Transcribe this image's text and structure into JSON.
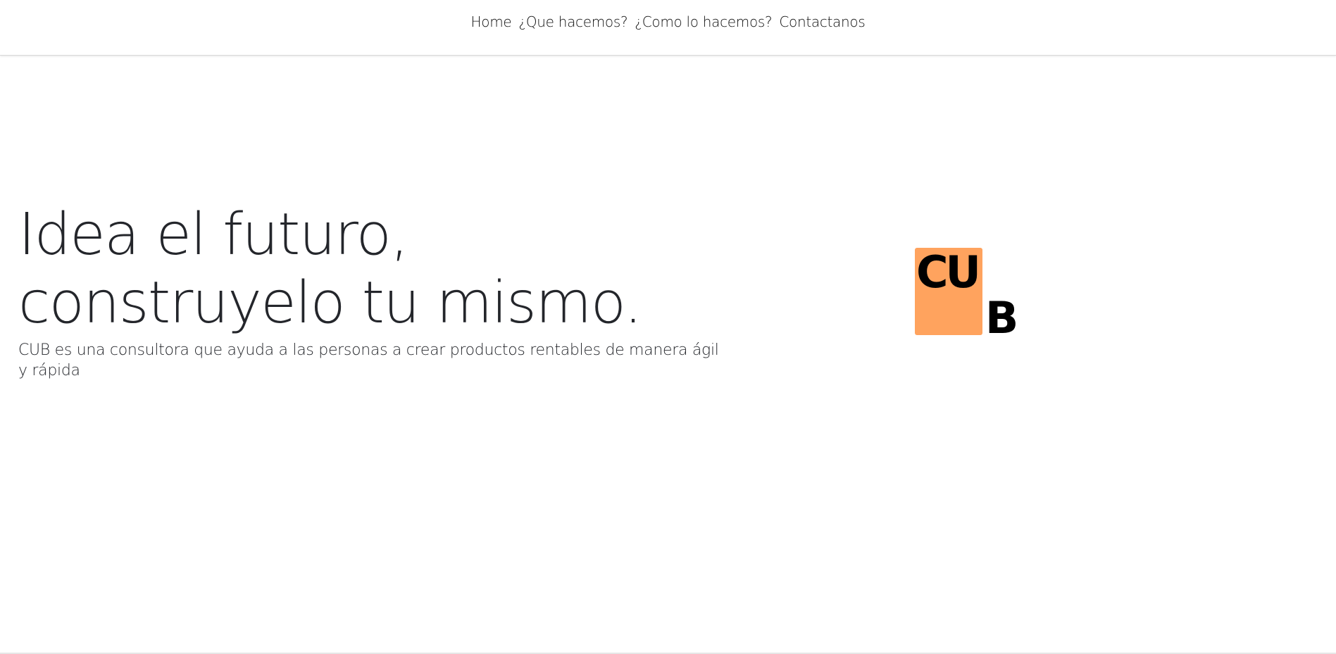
{
  "nav": {
    "items": [
      {
        "label": "Home"
      },
      {
        "label": "¿Que hacemos?"
      },
      {
        "label": "¿Como lo hacemos?"
      },
      {
        "label": "Contactanos"
      }
    ]
  },
  "hero": {
    "title_line1": "Idea el futuro,",
    "title_line2": "construyelo tu mismo.",
    "subtitle": "CUB es una consultora que ayuda a las personas a crear productos rentables de manera ágil y rápida"
  },
  "logo": {
    "text_cu": "CU",
    "text_b": "B"
  },
  "colors": {
    "accent": "#ffa35e",
    "text": "#24262b",
    "background": "#ffffff"
  }
}
